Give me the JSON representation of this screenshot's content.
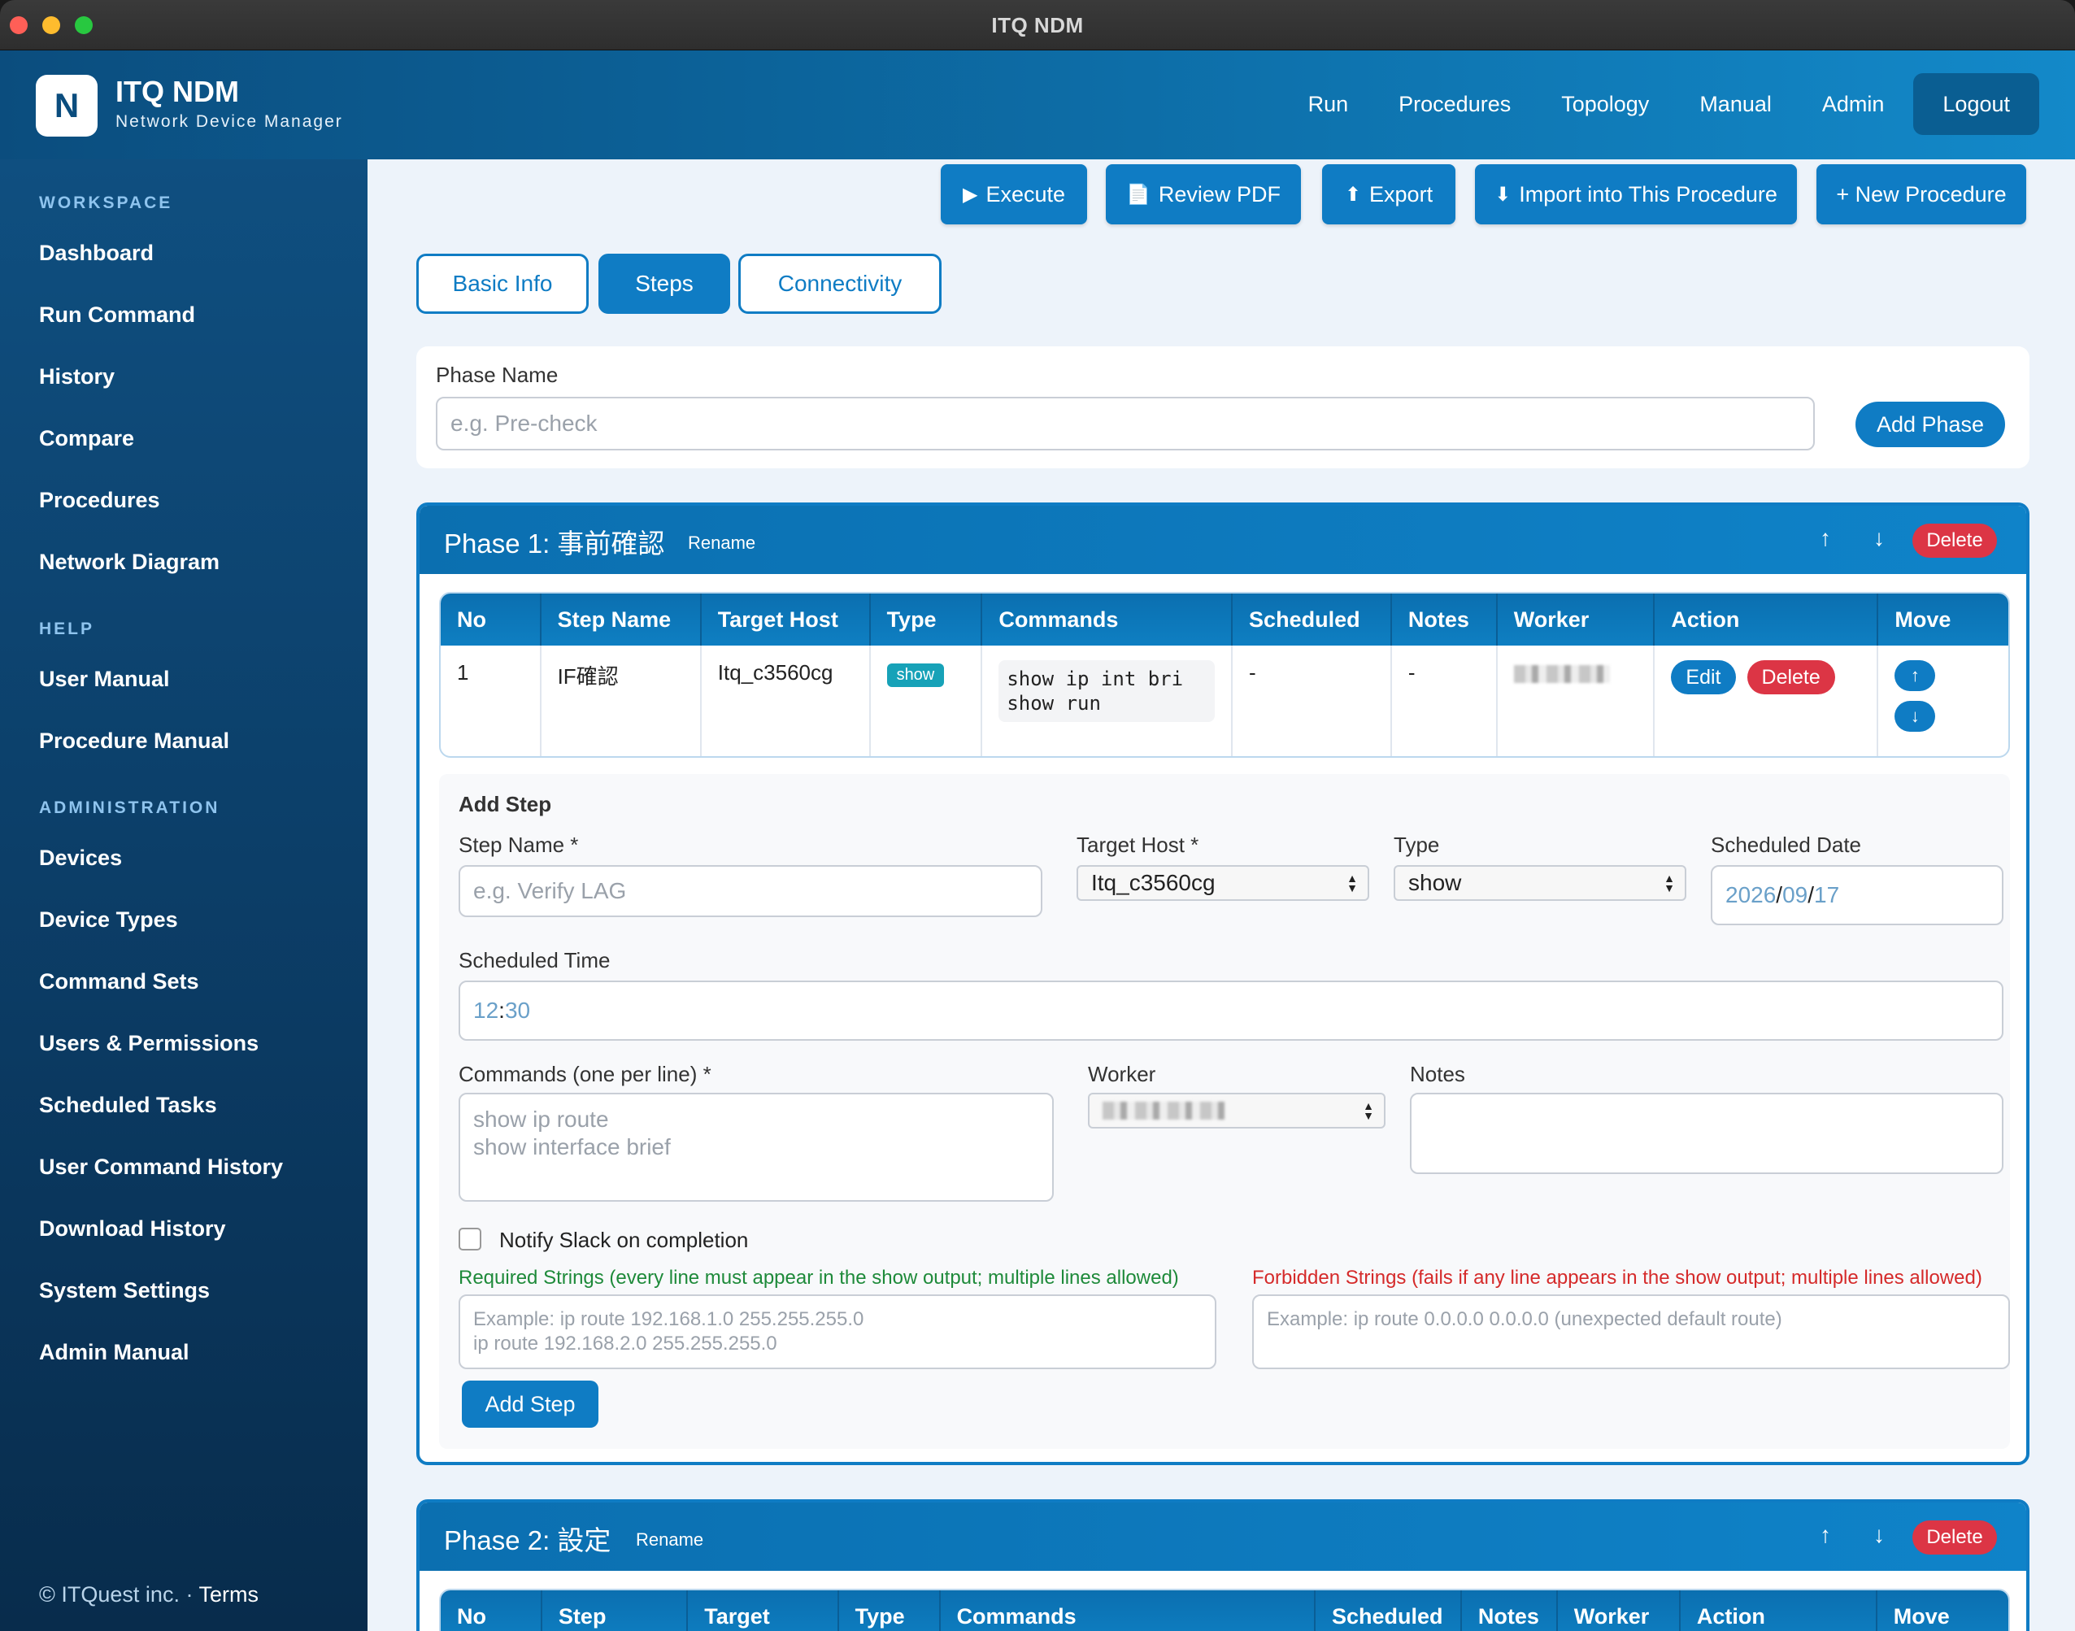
{
  "window": {
    "title": "ITQ NDM"
  },
  "brand": {
    "logo_letter": "N",
    "title": "ITQ NDM",
    "subtitle": "Network Device Manager"
  },
  "topnav": {
    "items": [
      "Run",
      "Procedures",
      "Topology",
      "Manual",
      "Admin"
    ],
    "logout": "Logout"
  },
  "sidebar": {
    "sections": [
      "WORKSPACE",
      "HELP",
      "ADMINISTRATION"
    ],
    "workspace": [
      "Dashboard",
      "Run Command",
      "History",
      "Compare",
      "Procedures",
      "Network Diagram"
    ],
    "help": [
      "User Manual",
      "Procedure Manual"
    ],
    "administration": [
      "Devices",
      "Device Types",
      "Command Sets",
      "Users & Permissions",
      "Scheduled Tasks",
      "User Command History",
      "Download History",
      "System Settings",
      "Admin Manual"
    ],
    "footer": {
      "copyright": "© ITQuest inc. ·",
      "terms": "Terms"
    }
  },
  "actions": {
    "execute": "Execute",
    "review_pdf": "Review PDF",
    "export": "Export",
    "import": "Import into This Procedure",
    "new_procedure": "+ New Procedure"
  },
  "tabs": [
    "Basic Info",
    "Steps",
    "Connectivity"
  ],
  "phase_form": {
    "label": "Phase Name",
    "placeholder": "e.g. Pre-check",
    "add_button": "Add Phase"
  },
  "table_headers": [
    "No",
    "Step Name",
    "Target Host",
    "Type",
    "Commands",
    "Scheduled",
    "Notes",
    "Worker",
    "Action",
    "Move"
  ],
  "phase2_headers": [
    "No",
    "Step",
    "Target",
    "Type",
    "Commands",
    "Scheduled",
    "Notes",
    "Worker",
    "Action",
    "Move"
  ],
  "phases": [
    {
      "title": "Phase 1: 事前確認",
      "rename": "Rename",
      "delete": "Delete",
      "steps": [
        {
          "no": "1",
          "name": "IF確認",
          "host": "Itq_c3560cg",
          "type": "show",
          "commands": "show ip int bri\nshow run",
          "scheduled": "-",
          "notes": "-",
          "edit": "Edit",
          "delete": "Delete"
        }
      ]
    },
    {
      "title": "Phase 2: 設定",
      "rename": "Rename",
      "delete": "Delete"
    }
  ],
  "add_step": {
    "heading": "Add Step",
    "step_name_label": "Step Name *",
    "step_name_placeholder": "e.g. Verify LAG",
    "target_host_label": "Target Host *",
    "target_host_value": "Itq_c3560cg",
    "type_label": "Type",
    "type_value": "show",
    "date_label": "Scheduled Date",
    "date_year": "2026",
    "date_month": "09",
    "date_day": "17",
    "time_label": "Scheduled Time",
    "time_hour": "12",
    "time_minute": "30",
    "commands_label": "Commands (one per line) *",
    "commands_placeholder": "show ip route\nshow interface brief",
    "worker_label": "Worker",
    "notes_label": "Notes",
    "notify_label": "Notify Slack on completion",
    "required_label": "Required Strings (every line must appear in the show output; multiple lines allowed)",
    "required_placeholder": "Example: ip route 192.168.1.0 255.255.255.0\nip route 192.168.2.0 255.255.255.0",
    "forbidden_label": "Forbidden Strings (fails if any line appears in the show output; multiple lines allowed)",
    "forbidden_placeholder": "Example: ip route 0.0.0.0 0.0.0.0 (unexpected default route)",
    "submit": "Add Step"
  },
  "colors": {
    "primary": "#0f7cc4",
    "danger": "#dc3545",
    "success_text": "#1e8a3a",
    "error_text": "#d52a2a",
    "sidebar": "#0b3a62"
  }
}
